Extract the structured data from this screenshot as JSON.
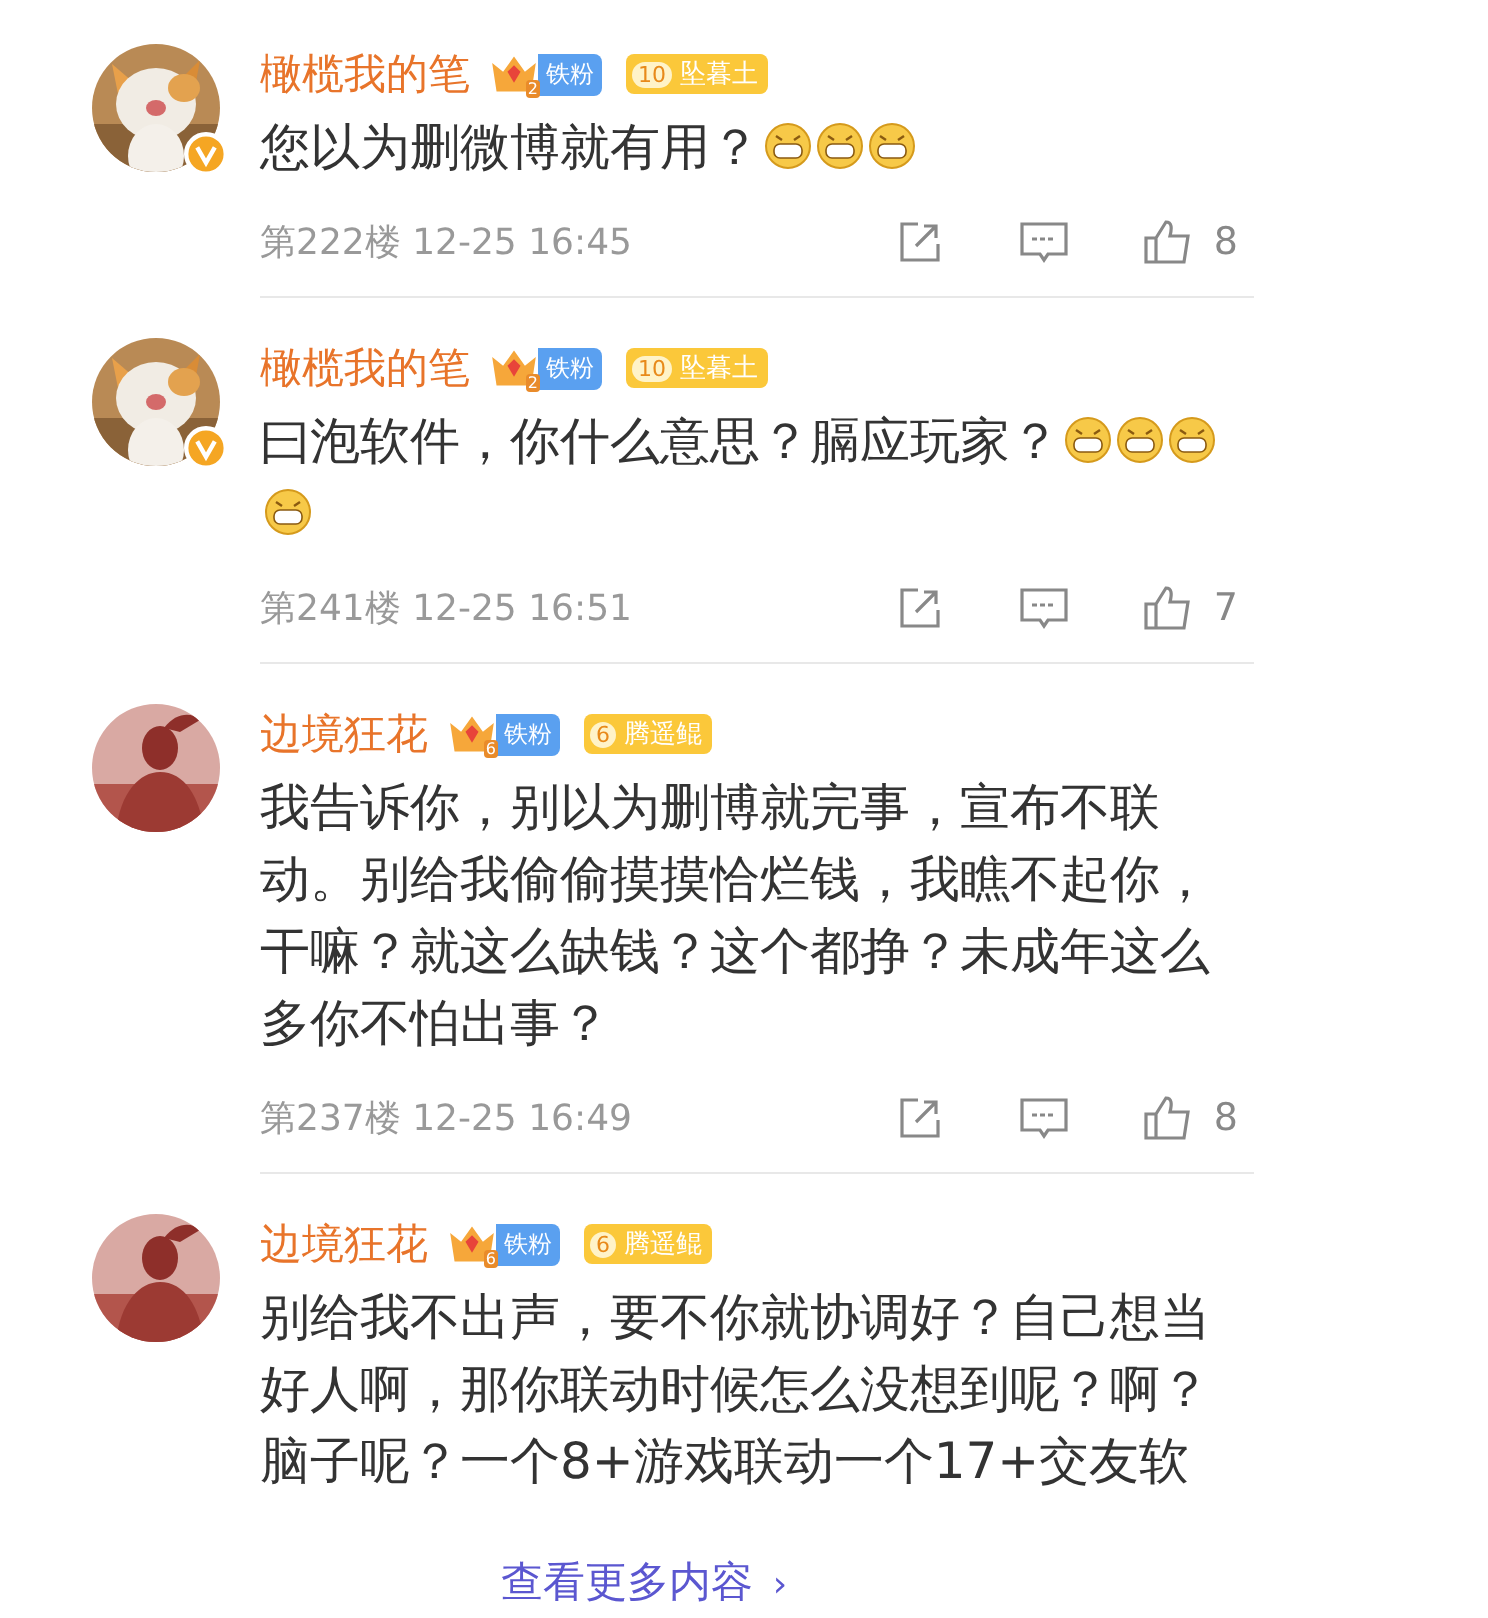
{
  "comments": [
    {
      "name": "橄榄我的笔",
      "avatar": {
        "kind": "cat",
        "verified": true
      },
      "fan_badge": {
        "rank": "2",
        "label": "铁粉"
      },
      "title_badge": {
        "rank": "10",
        "label": "坠暮土"
      },
      "text": "您以为删微博就有用？",
      "emojis": [
        {
          "kind": "grin"
        },
        {
          "kind": "grin"
        },
        {
          "kind": "grin"
        }
      ],
      "floor": "第222楼",
      "time": "12-25 16:45",
      "likes": "8"
    },
    {
      "name": "橄榄我的笔",
      "avatar": {
        "kind": "cat",
        "verified": true
      },
      "fan_badge": {
        "rank": "2",
        "label": "铁粉"
      },
      "title_badge": {
        "rank": "10",
        "label": "坠暮土"
      },
      "text": "曰泡软件，你什么意思？膈应玩家？",
      "emojis": [
        {
          "kind": "grin"
        },
        {
          "kind": "grin"
        },
        {
          "kind": "grin"
        },
        {
          "kind": "grin"
        }
      ],
      "floor": "第241楼",
      "time": "12-25 16:51",
      "likes": "7"
    },
    {
      "name": "边境狂花",
      "avatar": {
        "kind": "silhouette",
        "verified": false
      },
      "fan_badge": {
        "rank": "6",
        "label": "铁粉"
      },
      "title_badge": {
        "rank": "6",
        "label": "腾遥鲲"
      },
      "text": "我告诉你，别以为删博就完事，宣布不联动。别给我偷偷摸摸恰烂钱，我瞧不起你，干嘛？就这么缺钱？这个都挣？未成年这么多你不怕出事？",
      "floor": "第237楼",
      "time": "12-25 16:49",
      "likes": "8"
    },
    {
      "name": "边境狂花",
      "avatar": {
        "kind": "silhouette",
        "verified": false
      },
      "fan_badge": {
        "rank": "6",
        "label": "铁粉"
      },
      "title_badge": {
        "rank": "6",
        "label": "腾遥鲲"
      },
      "text": "别给我不出声，要不你就协调好？自己想当好人啊，那你联动时候怎么没想到呢？啊？脑子呢？一个8+游戏联动一个17+交友软"
    }
  ],
  "more_link": {
    "label": "查看更多内容",
    "arrow": "›"
  }
}
